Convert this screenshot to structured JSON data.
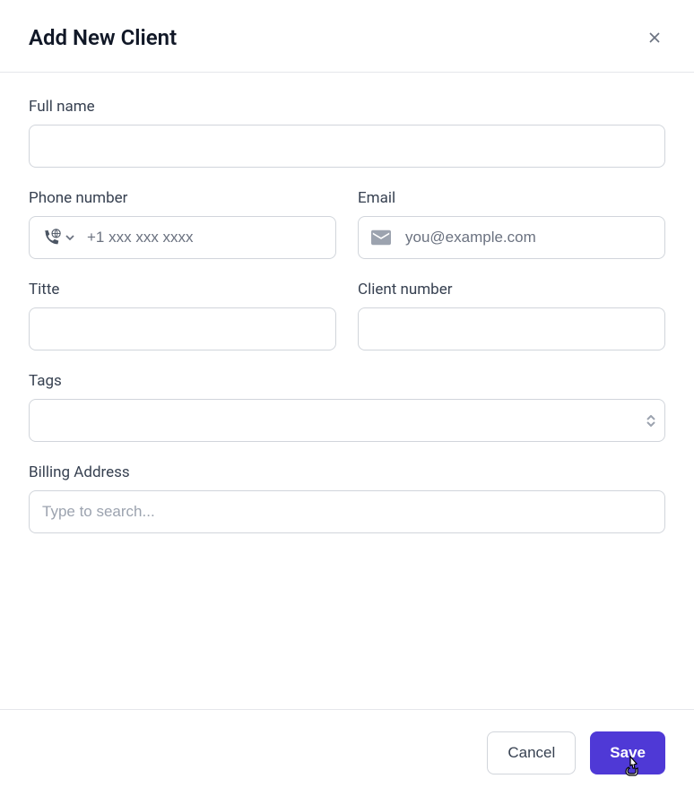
{
  "header": {
    "title": "Add New Client"
  },
  "form": {
    "full_name": {
      "label": "Full name",
      "value": ""
    },
    "phone": {
      "label": "Phone number",
      "placeholder": "+1 xxx xxx xxxx",
      "value": ""
    },
    "email": {
      "label": "Email",
      "placeholder": "you@example.com",
      "value": ""
    },
    "title": {
      "label": "Titte",
      "value": ""
    },
    "client_number": {
      "label": "Client number",
      "value": ""
    },
    "tags": {
      "label": "Tags",
      "value": ""
    },
    "billing_address": {
      "label": "Billing Address",
      "placeholder": "Type to search...",
      "value": ""
    }
  },
  "footer": {
    "cancel_label": "Cancel",
    "save_label": "Save"
  }
}
